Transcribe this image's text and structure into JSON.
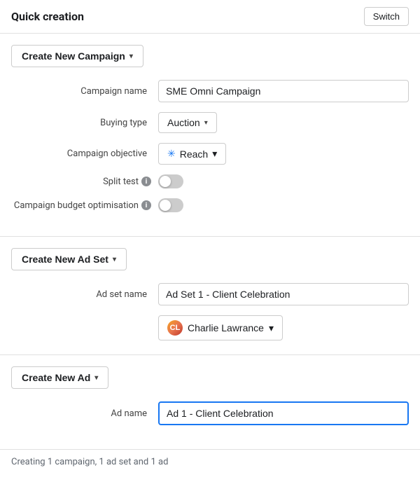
{
  "header": {
    "title": "Quick creation",
    "switch_label": "Switch"
  },
  "campaign_section": {
    "button_label": "Create New Campaign",
    "campaign_name_label": "Campaign name",
    "campaign_name_value": "SME Omni Campaign",
    "buying_type_label": "Buying type",
    "buying_type_value": "Auction",
    "campaign_objective_label": "Campaign objective",
    "campaign_objective_value": "Reach",
    "split_test_label": "Split test",
    "campaign_budget_label": "Campaign budget optimisation"
  },
  "ad_set_section": {
    "button_label": "Create New Ad Set",
    "ad_set_name_label": "Ad set name",
    "ad_set_name_value": "Ad Set 1 - Client Celebration",
    "person_name": "Charlie Lawrance"
  },
  "ad_section": {
    "button_label": "Create New Ad",
    "ad_name_label": "Ad name",
    "ad_name_value": "Ad 1 - Client Celebration"
  },
  "footer": {
    "text": "Creating 1 campaign, 1 ad set and 1 ad"
  },
  "icons": {
    "dropdown_arrow": "▾",
    "info": "i",
    "reach_icon": "✳"
  }
}
